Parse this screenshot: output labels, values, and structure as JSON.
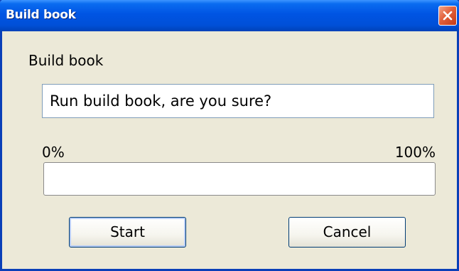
{
  "window": {
    "title": "Build book"
  },
  "dialog": {
    "heading": "Build book",
    "message": "Run build book, are you sure?"
  },
  "progress": {
    "min_label": "0%",
    "max_label": "100%",
    "value": 0
  },
  "buttons": {
    "start_label": "Start",
    "cancel_label": "Cancel"
  },
  "icons": {
    "close": "close-icon"
  },
  "colors": {
    "title_bar": "#0054e3",
    "window_background": "#ece9d8",
    "close_button": "#e2603a"
  }
}
